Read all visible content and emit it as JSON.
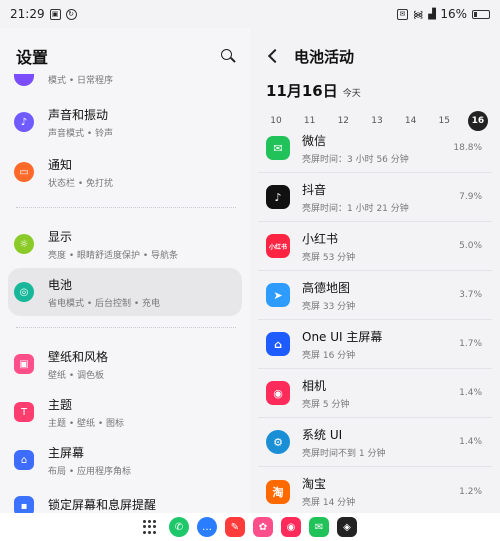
{
  "status_bar": {
    "time": "21:29",
    "battery": "16%"
  },
  "settings": {
    "title": "设置",
    "items": [
      {
        "title": "",
        "subtitle": "模式 • 日常程序",
        "icon": "modes-icon",
        "color": "#7c4dff"
      },
      {
        "title": "声音和振动",
        "subtitle": "声音模式 • 铃声",
        "icon": "sound-icon",
        "color": "#6f5bff"
      },
      {
        "title": "通知",
        "subtitle": "状态栏 • 免打扰",
        "icon": "notification-icon",
        "color": "#ff6a2a"
      },
      {
        "title": "显示",
        "subtitle": "亮度 • 眼睛舒适度保护 • 导航条",
        "icon": "display-icon",
        "color": "#8acb2a"
      },
      {
        "title": "电池",
        "subtitle": "省电模式 • 后台控制 • 充电",
        "icon": "battery-icon",
        "color": "#18b79a"
      },
      {
        "title": "壁纸和风格",
        "subtitle": "壁纸 • 调色板",
        "icon": "wallpaper-icon",
        "color": "#ff4f8b"
      },
      {
        "title": "主题",
        "subtitle": "主题 • 壁纸 • 图标",
        "icon": "theme-icon",
        "color": "#ff3d6e"
      },
      {
        "title": "主屏幕",
        "subtitle": "布局 • 应用程序角标",
        "icon": "home-icon",
        "color": "#3d6cff"
      },
      {
        "title": "锁定屏幕和息屏提醒",
        "subtitle": "",
        "icon": "lock-icon",
        "color": "#3b73ff"
      }
    ]
  },
  "battery_activity": {
    "title": "电池活动",
    "date": "11月16日",
    "date_sub": "今天",
    "days": [
      "10",
      "11",
      "12",
      "13",
      "14",
      "15",
      "16"
    ],
    "selected_day": "16",
    "apps": [
      {
        "name": "微信",
        "sub": "亮屏时间：3 小时 56 分钟",
        "pct": "18.8%",
        "icon": "wechat-icon",
        "color": "#22c25a",
        "glyph": "✉"
      },
      {
        "name": "抖音",
        "sub": "亮屏时间：1 小时 21 分钟",
        "pct": "7.9%",
        "icon": "douyin-icon",
        "color": "#111111",
        "glyph": "♪"
      },
      {
        "name": "小红书",
        "sub": "亮屏 53 分钟",
        "pct": "5.0%",
        "icon": "xiaohongshu-icon",
        "color": "#ff2442",
        "glyph": "小红书"
      },
      {
        "name": "高德地图",
        "sub": "亮屏 33 分钟",
        "pct": "3.7%",
        "icon": "amap-icon",
        "color": "#2e9bff",
        "glyph": "➤"
      },
      {
        "name": "One UI 主屏幕",
        "sub": "亮屏 16 分钟",
        "pct": "1.7%",
        "icon": "oneui-home-icon",
        "color": "#1f5cff",
        "glyph": "⌂"
      },
      {
        "name": "相机",
        "sub": "亮屏 5 分钟",
        "pct": "1.4%",
        "icon": "camera-icon",
        "color": "#ff2b5a",
        "glyph": "◉"
      },
      {
        "name": "系统 UI",
        "sub": "亮屏时间不到 1 分钟",
        "pct": "1.4%",
        "icon": "system-ui-icon",
        "color": "#1a8fd6",
        "glyph": "⚙"
      },
      {
        "name": "淘宝",
        "sub": "亮屏 14 分钟",
        "pct": "1.2%",
        "icon": "taobao-icon",
        "color": "#ff6a00",
        "glyph": "淘"
      }
    ]
  },
  "dock": {
    "apps": [
      {
        "icon": "phone-icon",
        "color": "#1ec76a",
        "glyph": "✆"
      },
      {
        "icon": "messages-icon",
        "color": "#2a7dff",
        "glyph": "…"
      },
      {
        "icon": "notes-icon",
        "color": "#ff3b3b",
        "glyph": "✎"
      },
      {
        "icon": "flower-icon",
        "color": "#ff4f8b",
        "glyph": "✿"
      },
      {
        "icon": "camera-icon",
        "color": "#ff2b5a",
        "glyph": "◉"
      },
      {
        "icon": "wechat-icon",
        "color": "#22c25a",
        "glyph": "✉"
      },
      {
        "icon": "game-icon",
        "color": "#222222",
        "glyph": "◈"
      }
    ]
  }
}
